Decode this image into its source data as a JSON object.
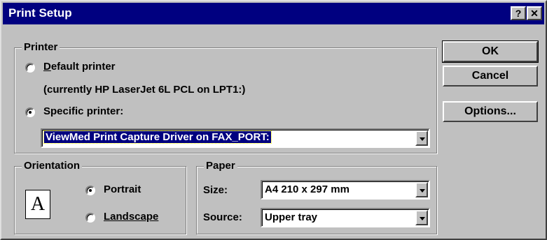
{
  "window": {
    "title": "Print Setup",
    "help_label": "?",
    "close_label": "✕"
  },
  "printer": {
    "group_label": "Printer",
    "default_label": "Default printer",
    "default_note": "(currently HP LaserJet 6L PCL on LPT1:)",
    "specific_label": "Specific printer:",
    "specific_selected": true,
    "selected_printer": "ViewMed Print Capture Driver on FAX_PORT:"
  },
  "orientation": {
    "group_label": "Orientation",
    "icon_letter": "A",
    "portrait_label": "Portrait",
    "landscape_label": "Landscape",
    "selected": "Portrait"
  },
  "paper": {
    "group_label": "Paper",
    "size_label": "Size:",
    "size_value": "A4 210 x 297 mm",
    "source_label": "Source:",
    "source_value": "Upper tray"
  },
  "buttons": {
    "ok": "OK",
    "cancel": "Cancel",
    "options": "Options..."
  },
  "colors": {
    "titlebar": "#000080",
    "face": "#c0c0c0",
    "selection": "#000080"
  }
}
